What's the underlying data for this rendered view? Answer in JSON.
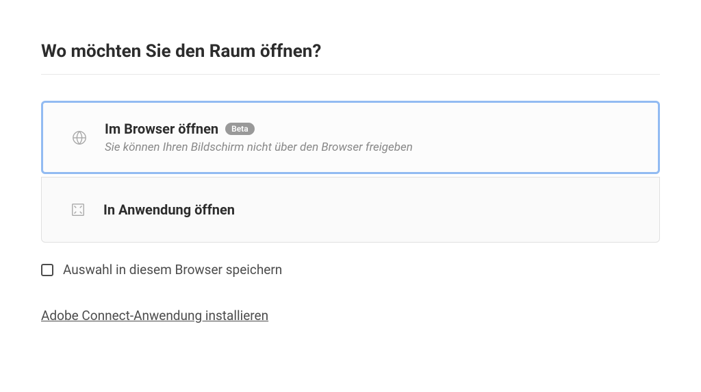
{
  "dialog": {
    "title": "Wo möchten Sie den Raum öffnen?",
    "options": {
      "browser": {
        "title": "Im Browser öffnen",
        "badge": "Beta",
        "subtitle": "Sie können Ihren Bildschirm nicht über den Browser freigeben",
        "selected": true
      },
      "app": {
        "title": "In Anwendung öffnen",
        "selected": false
      }
    },
    "remember": {
      "label": "Auswahl in diesem Browser speichern",
      "checked": false
    },
    "install_link": "Adobe Connect-Anwendung installieren"
  }
}
